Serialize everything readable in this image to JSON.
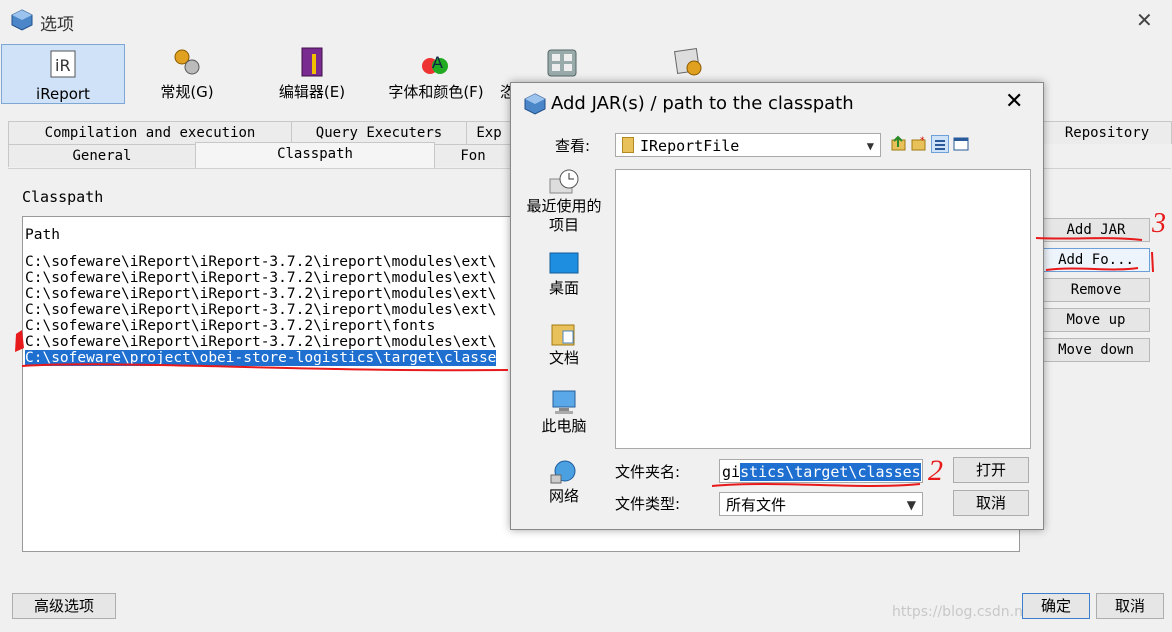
{
  "window": {
    "title": "选项",
    "close_glyph": "✕"
  },
  "top_buttons": [
    {
      "label": "iReport",
      "icon": "ireport-icon",
      "active": true
    },
    {
      "label": "常规(G)",
      "icon": "general-gears-icon"
    },
    {
      "label": "编辑器(E)",
      "icon": "editor-book-icon"
    },
    {
      "label": "字体和颜色(F)",
      "icon": "fonts-colors-icon"
    },
    {
      "label": "恣",
      "icon": "keymap-icon"
    },
    {
      "label": "",
      "icon": "misc-icon"
    }
  ],
  "tabs_row1": [
    "Compilation and execution",
    "Query Executers",
    "Exp",
    "Repository"
  ],
  "tabs_row2": [
    "General",
    "Classpath",
    "Fon"
  ],
  "classpath": {
    "label": "Classpath",
    "header": "Path",
    "rows": [
      "C:\\sofeware\\iReport\\iReport-3.7.2\\ireport\\modules\\ext\\",
      "C:\\sofeware\\iReport\\iReport-3.7.2\\ireport\\modules\\ext\\",
      "C:\\sofeware\\iReport\\iReport-3.7.2\\ireport\\modules\\ext\\",
      "C:\\sofeware\\iReport\\iReport-3.7.2\\ireport\\modules\\ext\\",
      "C:\\sofeware\\iReport\\iReport-3.7.2\\ireport\\fonts",
      "C:\\sofeware\\iReport\\iReport-3.7.2\\ireport\\modules\\ext\\",
      "C:\\sofeware\\project\\obei-store-logistics\\target\\classe"
    ],
    "selected_index": 6
  },
  "right_buttons": [
    "Add JAR",
    "Add Fo...",
    "Remove",
    "Move up",
    "Move down"
  ],
  "bottom": {
    "advanced": "高级选项",
    "ok": "确定",
    "cancel": "取消"
  },
  "watermark": "https://blog.csdn.net/...",
  "dialog": {
    "title": "Add JAR(s) / path to the classpath",
    "close_glyph": "✕",
    "look_in_label": "查看:",
    "look_in_value": "IReportFile",
    "sidebar": [
      {
        "label": "最近使用的项目",
        "icon": "recent-clock-icon"
      },
      {
        "label": "桌面",
        "icon": "desktop-icon"
      },
      {
        "label": "文档",
        "icon": "documents-folder-icon"
      },
      {
        "label": "此电脑",
        "icon": "computer-icon"
      },
      {
        "label": "网络",
        "icon": "network-globe-icon"
      }
    ],
    "folder_name_label": "文件夹名:",
    "folder_name_prefix": "gi",
    "folder_name_selected": "stics\\target\\classes",
    "file_type_label": "文件类型:",
    "file_type_value": "所有文件",
    "open_button": "打开",
    "cancel_button": "取消"
  },
  "annotations": {
    "n2": "2",
    "n3": "3"
  },
  "colors": {
    "selection": "#1e6fd0",
    "annotation_red": "#e8191a",
    "active_tab": "#cfe2f7"
  }
}
